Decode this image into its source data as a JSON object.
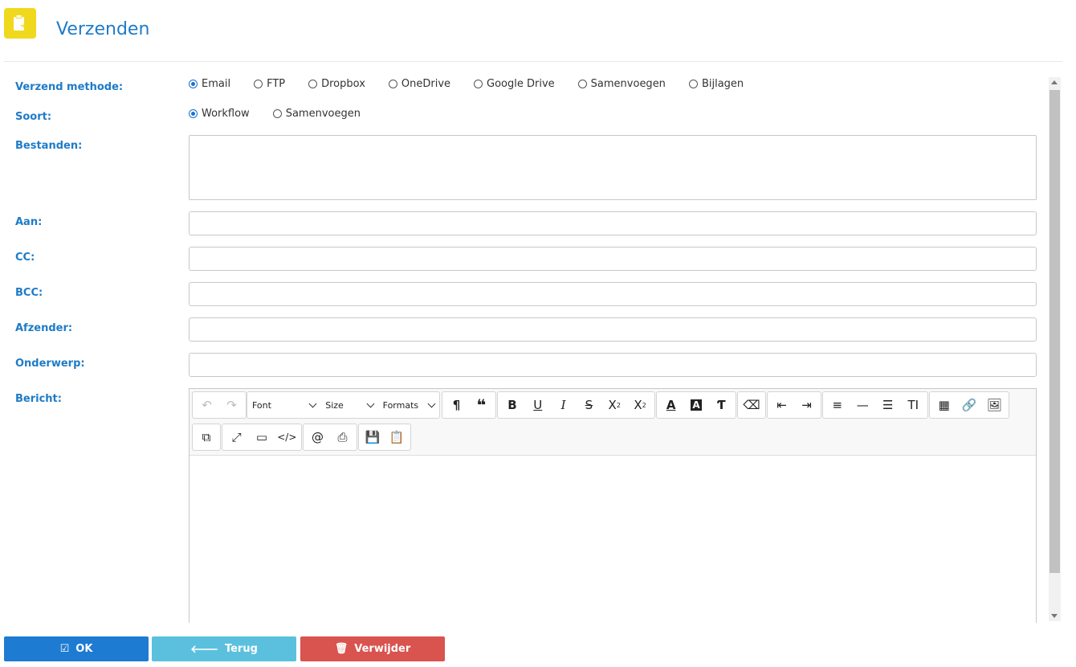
{
  "header": {
    "title": "Verzenden",
    "icon": "clipboard-send-icon"
  },
  "labels": {
    "method": "Verzend methode:",
    "kind": "Soort:",
    "files": "Bestanden:",
    "to": "Aan:",
    "cc": "CC:",
    "bcc": "BCC:",
    "sender": "Afzender:",
    "subject": "Onderwerp:",
    "message": "Bericht:"
  },
  "method_options": [
    "Email",
    "FTP",
    "Dropbox",
    "OneDrive",
    "Google Drive",
    "Samenvoegen",
    "Bijlagen"
  ],
  "method_selected": "Email",
  "kind_options": [
    "Workflow",
    "Samenvoegen"
  ],
  "kind_selected": "Workflow",
  "fields": {
    "to": "",
    "cc": "",
    "bcc": "",
    "sender": "",
    "subject": "",
    "files": ""
  },
  "editor": {
    "font_label": "Font",
    "size_label": "Size",
    "formats_label": "Formats",
    "body": ""
  },
  "buttons": {
    "ok": "OK",
    "back": "Terug",
    "delete": "Verwijder"
  },
  "colors": {
    "accent": "#1e7bc8",
    "ok": "#1e7bd2",
    "back": "#5bc0de",
    "delete": "#d9534f",
    "header_icon": "#f0d91d"
  }
}
